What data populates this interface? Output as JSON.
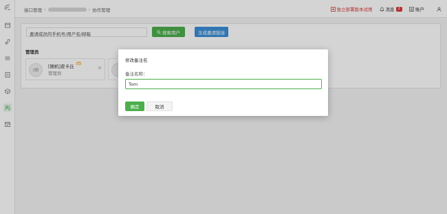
{
  "breadcrumb": {
    "item1": "接口管理",
    "item3": "协作管理"
  },
  "topbar": {
    "trial_label": "独立部署版本试用",
    "message_label": "消息",
    "message_count": "2",
    "account_label": "账户"
  },
  "search": {
    "placeholder": "邀请成员的手机号/用户名/邮箱",
    "search_button": "搜索用户",
    "invite_button": "生成邀请链接"
  },
  "section": {
    "title": "管理员"
  },
  "member": {
    "avatar_text": "[随",
    "name": "[随机]皮卡丘",
    "role": "管理员"
  },
  "dialog": {
    "title": "修改备注名",
    "label": "备注名称：",
    "value": "Tom",
    "ok_label": "确定",
    "cancel_label": "取消"
  },
  "colors": {
    "primary_green": "#4cae4c",
    "primary_blue": "#3a8fd6",
    "alert_red": "#d93a3a"
  },
  "icons": [
    "logo-icon",
    "api-icon",
    "link-icon",
    "list-icon",
    "doc-icon",
    "box-icon",
    "team-icon",
    "calendar-icon",
    "trial-icon",
    "bell-icon",
    "account-icon",
    "user-icon",
    "search-icon",
    "crown-icon",
    "menu-icon"
  ]
}
